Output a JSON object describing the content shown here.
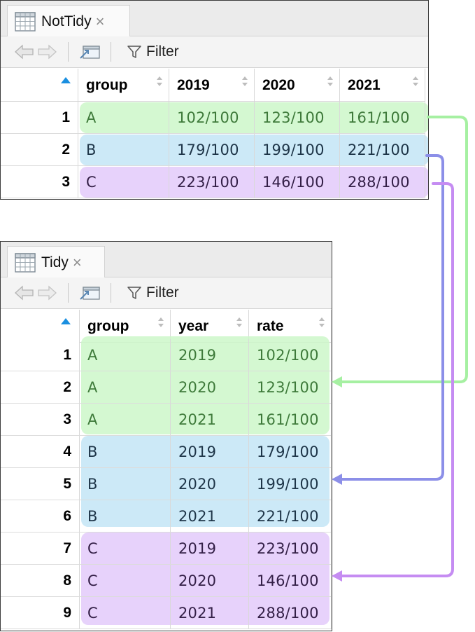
{
  "not_tidy": {
    "tab_label": "NotTidy",
    "tab_icon": "table-grid-icon",
    "close_glyph": "×",
    "filter_label": "Filter",
    "columns": [
      "group",
      "2019",
      "2020",
      "2021"
    ],
    "rows": [
      {
        "index": "1",
        "cells": [
          "A",
          "102/100",
          "123/100",
          "161/100"
        ]
      },
      {
        "index": "2",
        "cells": [
          "B",
          "179/100",
          "199/100",
          "221/100"
        ]
      },
      {
        "index": "3",
        "cells": [
          "C",
          "223/100",
          "146/100",
          "288/100"
        ]
      }
    ]
  },
  "tidy": {
    "tab_label": "Tidy",
    "tab_icon": "table-grid-icon",
    "close_glyph": "×",
    "filter_label": "Filter",
    "columns": [
      "group",
      "year",
      "rate"
    ],
    "rows": [
      {
        "index": "1",
        "cells": [
          "A",
          "2019",
          "102/100"
        ]
      },
      {
        "index": "2",
        "cells": [
          "A",
          "2020",
          "123/100"
        ]
      },
      {
        "index": "3",
        "cells": [
          "A",
          "2021",
          "161/100"
        ]
      },
      {
        "index": "4",
        "cells": [
          "B",
          "2019",
          "179/100"
        ]
      },
      {
        "index": "5",
        "cells": [
          "B",
          "2020",
          "199/100"
        ]
      },
      {
        "index": "6",
        "cells": [
          "B",
          "2021",
          "221/100"
        ]
      },
      {
        "index": "7",
        "cells": [
          "C",
          "2019",
          "223/100"
        ]
      },
      {
        "index": "8",
        "cells": [
          "C",
          "2020",
          "146/100"
        ]
      },
      {
        "index": "9",
        "cells": [
          "C",
          "2021",
          "288/100"
        ]
      }
    ]
  },
  "colors": {
    "group_a_band": "#ccf7c9",
    "group_b_band": "#c9e8f7",
    "group_c_band": "#e6d0fb",
    "arrow_a": "#a6f0a2",
    "arrow_b": "#8c8fe8",
    "arrow_c": "#c58cf2",
    "sort_indicator": "#1a8fe0"
  },
  "toolbar_icons": [
    "back-arrow-icon",
    "forward-arrow-icon",
    "popout-window-icon",
    "filter-funnel-icon"
  ]
}
